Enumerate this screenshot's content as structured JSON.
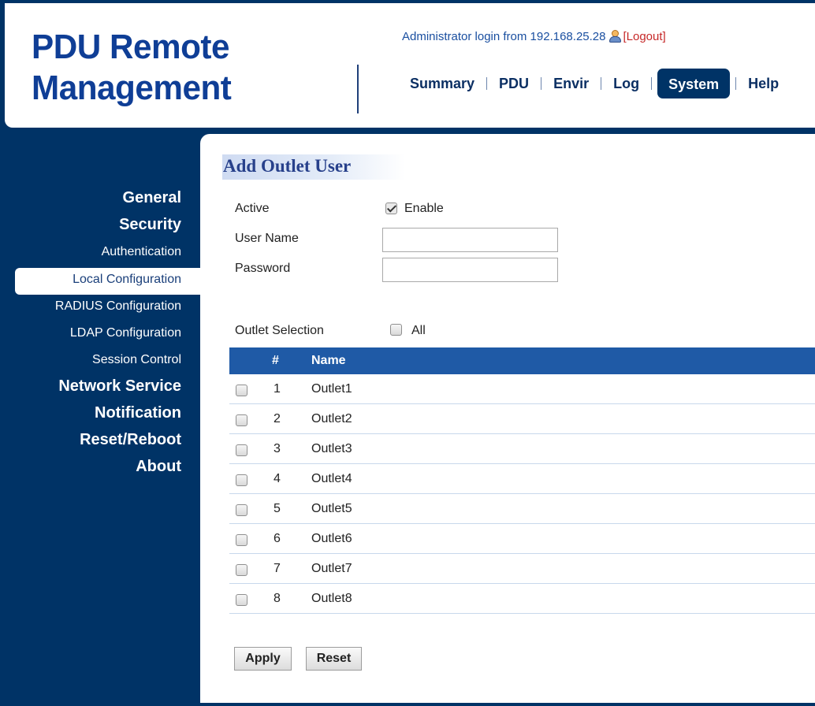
{
  "header": {
    "logo_line1": "PDU Remote",
    "logo_line2": "Management",
    "login_text": "Administrator login from 192.168.25.28",
    "logout_open": "[",
    "logout_label": "Logout",
    "logout_close": "]"
  },
  "topnav": {
    "items": [
      {
        "label": "Summary",
        "active": false
      },
      {
        "label": "PDU",
        "active": false
      },
      {
        "label": "Envir",
        "active": false
      },
      {
        "label": "Log",
        "active": false
      },
      {
        "label": "System",
        "active": true
      },
      {
        "label": "Help",
        "active": false
      }
    ]
  },
  "sidebar": {
    "items": [
      {
        "label": "General",
        "level": "main"
      },
      {
        "label": "Security",
        "level": "main"
      },
      {
        "label": "Authentication",
        "level": "sub"
      },
      {
        "label": "Local Configuration",
        "level": "sub",
        "active": true
      },
      {
        "label": "RADIUS Configuration",
        "level": "sub"
      },
      {
        "label": "LDAP Configuration",
        "level": "sub"
      },
      {
        "label": "Session Control",
        "level": "sub"
      },
      {
        "label": "Network Service",
        "level": "main"
      },
      {
        "label": "Notification",
        "level": "main"
      },
      {
        "label": "Reset/Reboot",
        "level": "main"
      },
      {
        "label": "About",
        "level": "main"
      }
    ]
  },
  "form": {
    "title": "Add Outlet User",
    "active_label": "Active",
    "enable_label": "Enable",
    "enable_checked": true,
    "username_label": "User Name",
    "username_value": "",
    "password_label": "Password",
    "password_value": "",
    "outlet_selection_label": "Outlet Selection",
    "all_label": "All",
    "all_checked": false
  },
  "table": {
    "col_num": "#",
    "col_name": "Name",
    "rows": [
      {
        "num": "1",
        "name": "Outlet1",
        "checked": false
      },
      {
        "num": "2",
        "name": "Outlet2",
        "checked": false
      },
      {
        "num": "3",
        "name": "Outlet3",
        "checked": false
      },
      {
        "num": "4",
        "name": "Outlet4",
        "checked": false
      },
      {
        "num": "5",
        "name": "Outlet5",
        "checked": false
      },
      {
        "num": "6",
        "name": "Outlet6",
        "checked": false
      },
      {
        "num": "7",
        "name": "Outlet7",
        "checked": false
      },
      {
        "num": "8",
        "name": "Outlet8",
        "checked": false
      }
    ]
  },
  "buttons": {
    "apply": "Apply",
    "reset": "Reset"
  },
  "icons": {
    "user": "user-icon"
  },
  "colors": {
    "brand_dark": "#003366",
    "logo_blue": "#0f3e96",
    "table_header": "#1f5aa6",
    "logout_red": "#c62828"
  }
}
